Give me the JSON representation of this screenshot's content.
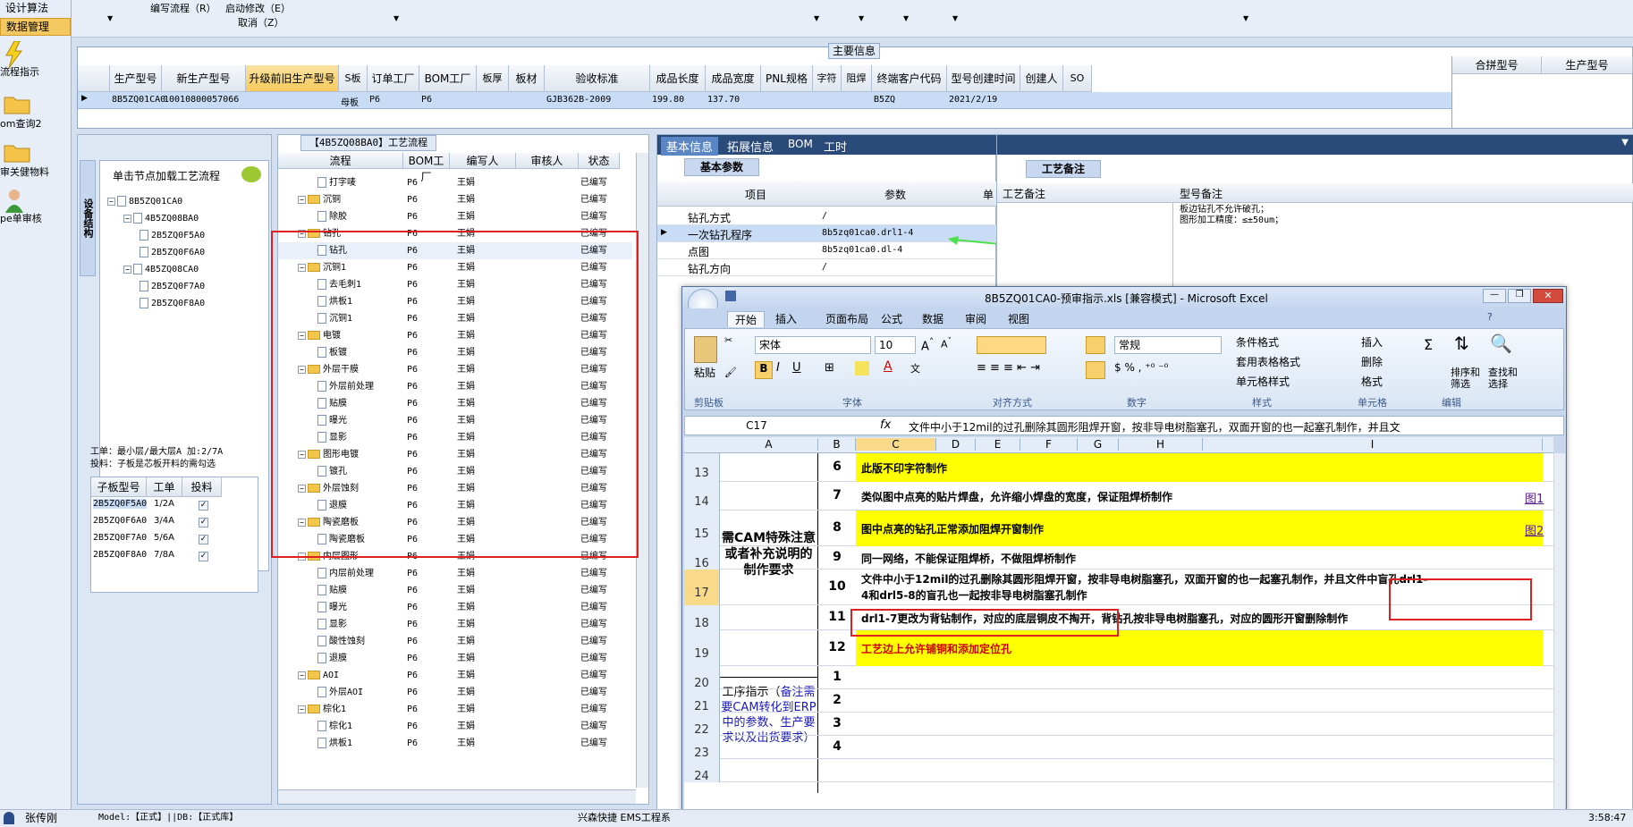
{
  "leftnav": {
    "top_items": [
      "设计算法",
      "数据管理"
    ],
    "items": [
      "流程指示",
      "om查询2",
      "审关健物料",
      "pe单审核"
    ]
  },
  "topmenu": {
    "items": [
      "编写流程（R）",
      "启动修改（E）",
      "取消（Z）"
    ]
  },
  "main": {
    "title": "主要信息",
    "columns": [
      "生产型号",
      "新生产型号",
      "升级前旧生产型号",
      "S板",
      "订单工厂",
      "BOM工厂",
      "板厚",
      "板材",
      "验收标准",
      "成品长度",
      "成品宽度",
      "PNL规格",
      "字符",
      "阻焊",
      "终端客户代码",
      "型号创建时间",
      "创建人",
      "SO"
    ],
    "row": [
      "8B5ZQ01CA0",
      "10010800057066",
      "",
      "母板",
      "P6",
      "P6",
      "",
      "",
      "GJB362B-2009",
      "199.80",
      "137.70",
      "",
      "",
      "",
      "B5ZQ",
      "2021/2/19",
      "",
      ""
    ],
    "right_columns": [
      "合拼型号",
      "生产型号"
    ]
  },
  "tree_panel": {
    "side_tab": "设备结构",
    "title": "单击节点加载工艺流程",
    "nodes": [
      "8B5ZQ01CA0",
      "4B5ZQ08BA0",
      "2B5ZQ0F5A0",
      "2B5ZQ0F6A0",
      "4B5ZQ08CA0",
      "2B5ZQ0F7A0",
      "2B5ZQ0F8A0"
    ],
    "info1": "工单：最小层/最大层A  加:2/7A",
    "info2": "投料：子板是芯板开料的需勾选",
    "sub_headers": [
      "子板型号",
      "工单",
      "投料"
    ],
    "sub_rows": [
      [
        "2B5ZQ0F5A0",
        "1/2A"
      ],
      [
        "2B5ZQ0F6A0",
        "3/4A"
      ],
      [
        "2B5ZQ0F7A0",
        "5/6A"
      ],
      [
        "2B5ZQ0F8A0",
        "7/8A"
      ]
    ]
  },
  "flow_panel": {
    "title": "【4B5ZQ08BA0】工艺流程",
    "headers": [
      "流程",
      "BOM工厂",
      "编写人",
      "审核人",
      "状态"
    ],
    "rows": [
      [
        "打字唛",
        2
      ],
      [
        "沉铜",
        1
      ],
      [
        "除胶",
        2
      ],
      [
        "钻孔",
        1
      ],
      [
        "钻孔",
        2
      ],
      [
        "沉铜1",
        1
      ],
      [
        "去毛刺1",
        2
      ],
      [
        "烘板1",
        2
      ],
      [
        "沉铜1",
        2
      ],
      [
        "电镀",
        1
      ],
      [
        "板镀",
        2
      ],
      [
        "外层干膜",
        1
      ],
      [
        "外层前处理",
        2
      ],
      [
        "贴膜",
        2
      ],
      [
        "曝光",
        2
      ],
      [
        "显影",
        2
      ],
      [
        "图形电镀",
        1
      ],
      [
        "镀孔",
        2
      ],
      [
        "外层蚀刻",
        1
      ],
      [
        "退膜",
        2
      ],
      [
        "陶瓷磨板",
        1
      ],
      [
        "陶瓷磨板",
        2
      ],
      [
        "内层图形",
        1
      ],
      [
        "内层前处理",
        2
      ],
      [
        "贴膜",
        2
      ],
      [
        "曝光",
        2
      ],
      [
        "显影",
        2
      ],
      [
        "酸性蚀刻",
        2
      ],
      [
        "退膜",
        2
      ],
      [
        "AOI",
        1
      ],
      [
        "外层AOI",
        2
      ],
      [
        "棕化1",
        1
      ],
      [
        "棕化1",
        2
      ],
      [
        "烘板1",
        2
      ]
    ],
    "bom": "P6",
    "writer": "王娟",
    "status": "已编写"
  },
  "info_panel": {
    "tabs": [
      "基本信息",
      "拓展信息",
      "BOM",
      "工时"
    ],
    "sub_tab": "基本参数",
    "headers": [
      "项目",
      "参数",
      "单"
    ],
    "rows": [
      [
        "钻孔方式",
        "/"
      ],
      [
        "一次钻孔程序",
        "8b5zq01ca0.drl1-4"
      ],
      [
        "点图",
        "8b5zq01ca0.dl-4"
      ],
      [
        "钻孔方向",
        "/"
      ]
    ]
  },
  "remark_panel": {
    "tab": "工艺备注",
    "headers": [
      "工艺备注",
      "型号备注"
    ],
    "note1": "板边钻孔不允许破孔；",
    "note2": "图形加工精度：≤±50um；"
  },
  "excel": {
    "title": "8B5ZQ01CA0-预审指示.xls  [兼容模式] - Microsoft Excel",
    "tabs": [
      "开始",
      "插入",
      "页面布局",
      "公式",
      "数据",
      "审阅",
      "视图"
    ],
    "font": "宋体",
    "size": "10",
    "format": "常规",
    "groups": [
      "剪贴板",
      "字体",
      "对齐方式",
      "数字",
      "样式",
      "单元格",
      "编辑"
    ],
    "buttons": {
      "paste": "粘贴",
      "cond": "条件格式",
      "table": "套用表格格式",
      "cellstyle": "单元格样式",
      "insert": "插入",
      "delete": "删除",
      "format": "格式",
      "sort": "排序和筛选",
      "find": "查找和选择"
    },
    "cellref": "C17",
    "fx": "fx",
    "formula": "文件中小于12mil的过孔删除其圆形阻焊开窗，按非导电树脂塞孔，双面开窗的也一起塞孔制作，并且文",
    "cols": [
      "A",
      "B",
      "C",
      "D",
      "E",
      "F",
      "G",
      "H",
      "I"
    ],
    "label1": "需CAM特殊注意或者补充说明的制作要求",
    "label2a": "工序指示（",
    "label2b": "备注需要CAM转化到ERP中的参数、生产要求以及出货要求）",
    "rows": [
      {
        "rn": "13",
        "n": "6",
        "t": "此版不印字符制作",
        "y": true
      },
      {
        "rn": "14",
        "n": "7",
        "t": "类似图中点亮的贴片焊盘，允许缩小焊盘的宽度，保证阻焊桥制作",
        "y": false,
        "link": "图1"
      },
      {
        "rn": "15",
        "n": "8",
        "t": "图中点亮的钻孔正常添加阻焊开窗制作",
        "y": true,
        "link": "图2"
      },
      {
        "rn": "16",
        "n": "9",
        "t": "同一网络，不能保证阻焊桥，不做阻焊桥制作",
        "y": false
      },
      {
        "rn": "17",
        "n": "10",
        "t": "文件中小于12mil的过孔删除其圆形阻焊开窗，按非导电树脂塞孔，双面开窗的也一起塞孔制作，并且文件中盲孔drl1-",
        "t2": "4和drl5-8的盲孔也一起按非导电树脂塞孔制作",
        "y": false
      },
      {
        "rn": "18",
        "n": "11",
        "t": "drl1-7更改为背钻制作，对应的底层铜皮不掏开，背钻孔按非导电树脂塞孔，对应的圆形开窗删除制作",
        "y": false
      },
      {
        "rn": "19",
        "n": "12",
        "t": "工艺边上允许铺铜和添加定位孔",
        "y": true,
        "red": true
      },
      {
        "rn": "20",
        "n": "1",
        "t": ""
      },
      {
        "rn": "21",
        "n": "2",
        "t": ""
      },
      {
        "rn": "22",
        "n": "3",
        "t": ""
      },
      {
        "rn": "23",
        "n": "4",
        "t": ""
      },
      {
        "rn": "24",
        "n": "",
        "t": ""
      }
    ]
  },
  "status": {
    "user": "张传刚",
    "model": "Model:【正式】||DB:【正式库】",
    "app": "兴森快捷  EMS工程系",
    "time": "3:58:47"
  }
}
